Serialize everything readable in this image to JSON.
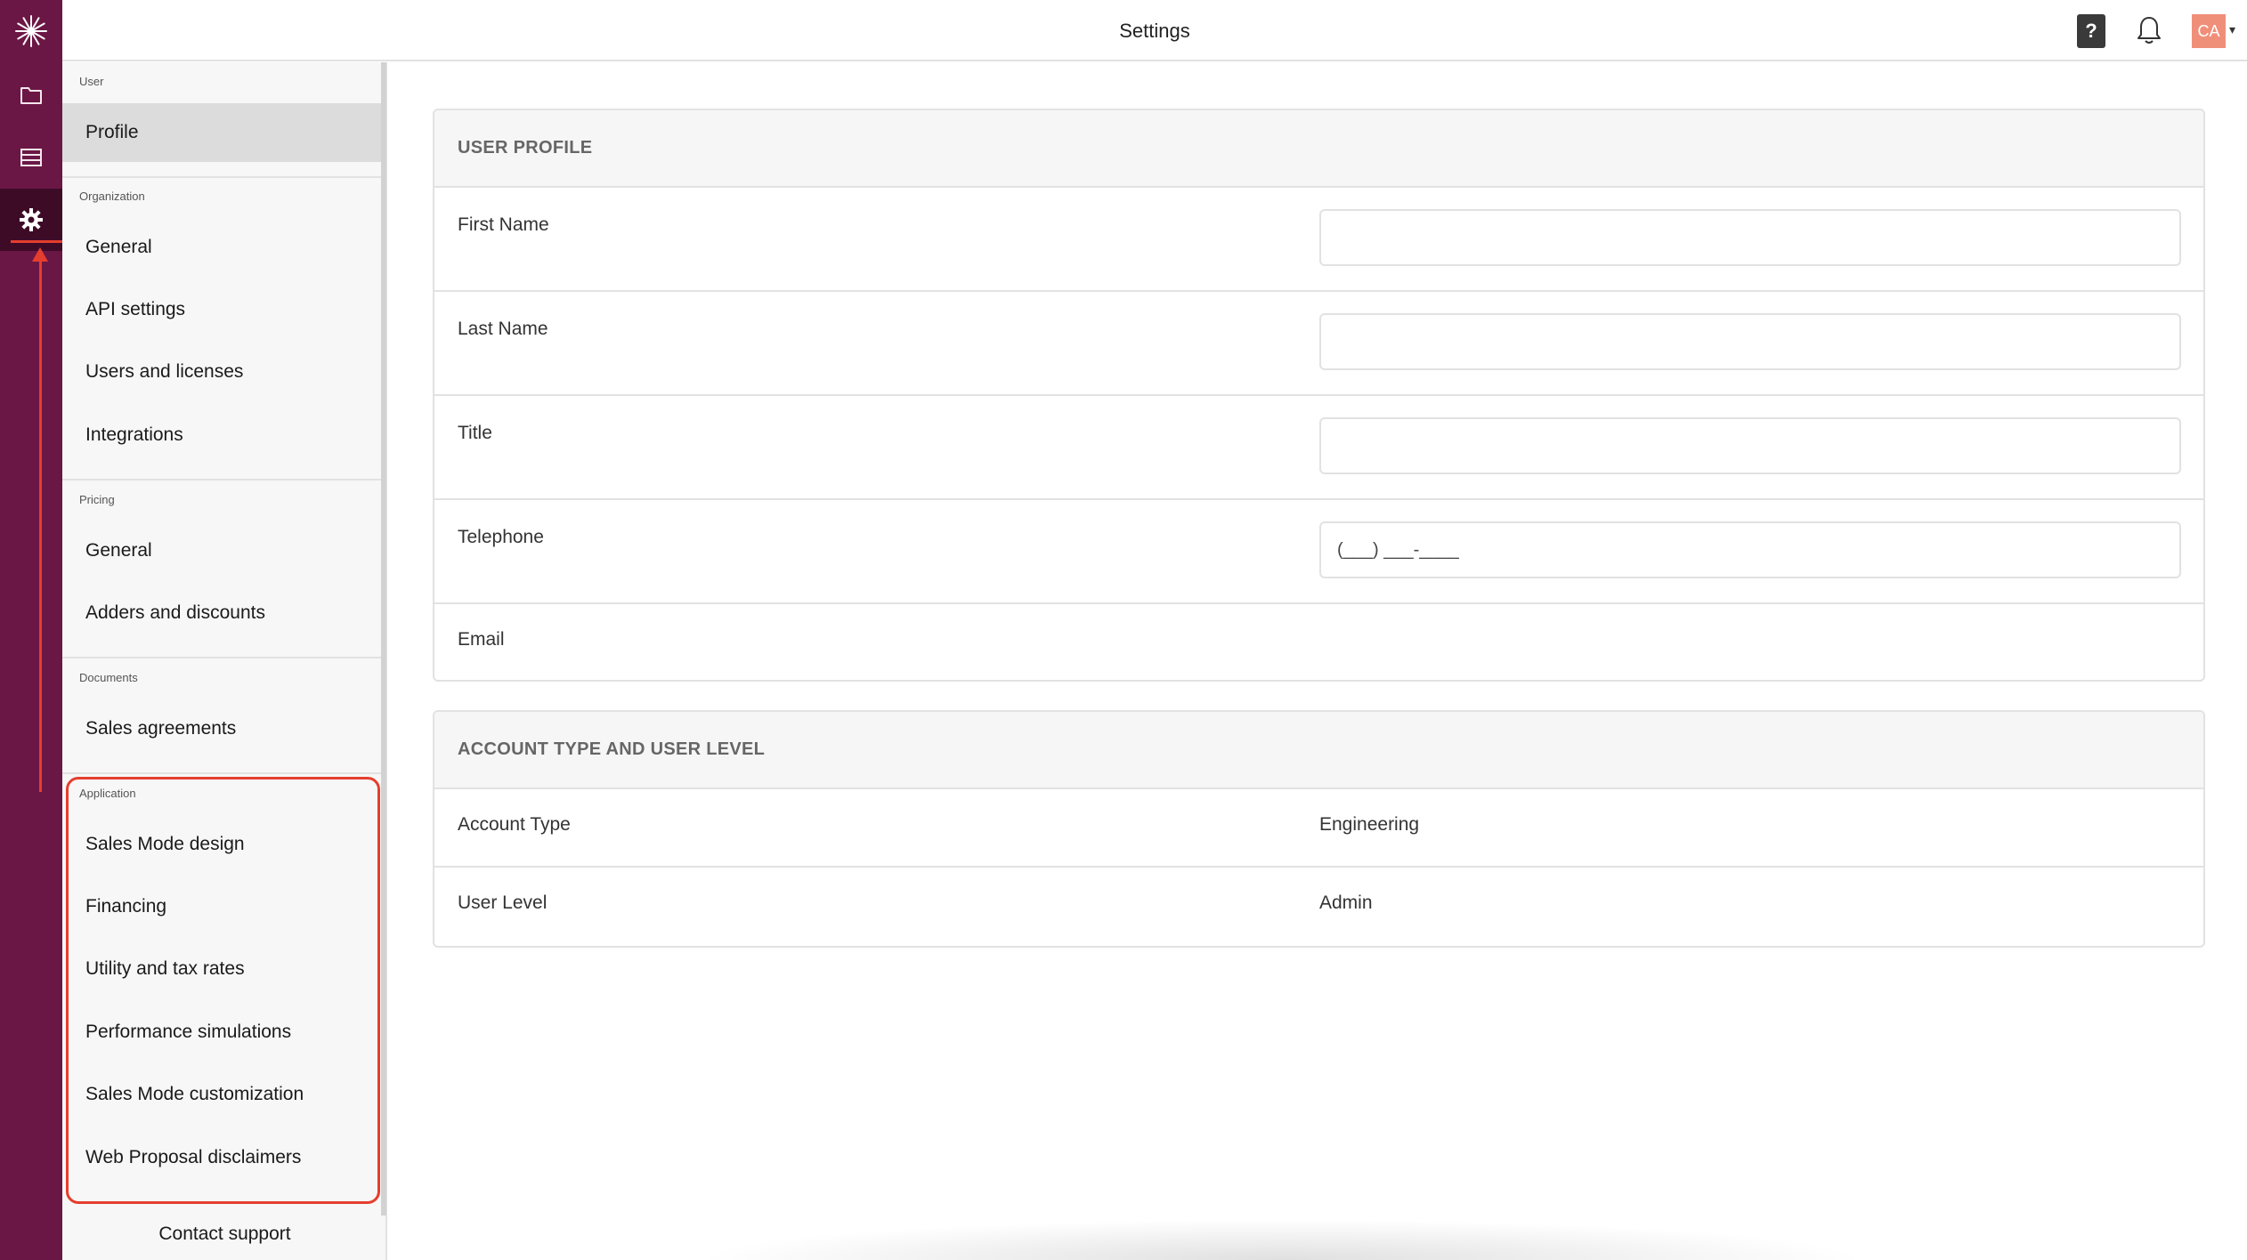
{
  "topbar": {
    "title": "Settings",
    "help_label": "?",
    "avatar_initials": "CA"
  },
  "rail": {
    "items": [
      {
        "icon": "sunburst-logo-icon"
      },
      {
        "icon": "folder-icon"
      },
      {
        "icon": "list-icon"
      },
      {
        "icon": "gear-icon",
        "active": true
      }
    ]
  },
  "sidebar": {
    "sections": [
      {
        "header": "User",
        "items": [
          {
            "label": "Profile",
            "selected": true
          }
        ]
      },
      {
        "header": "Organization",
        "items": [
          {
            "label": "General"
          },
          {
            "label": "API settings"
          },
          {
            "label": "Users and licenses"
          },
          {
            "label": "Integrations"
          }
        ]
      },
      {
        "header": "Pricing",
        "items": [
          {
            "label": "General"
          },
          {
            "label": "Adders and discounts"
          }
        ]
      },
      {
        "header": "Documents",
        "items": [
          {
            "label": "Sales agreements"
          }
        ]
      },
      {
        "header": "Application",
        "items": [
          {
            "label": "Sales Mode design"
          },
          {
            "label": "Financing"
          },
          {
            "label": "Utility and tax rates"
          },
          {
            "label": "Performance simulations"
          },
          {
            "label": "Sales Mode customization"
          },
          {
            "label": "Web Proposal disclaimers"
          }
        ]
      }
    ],
    "contact_support": "Contact support"
  },
  "user_profile": {
    "header": "USER PROFILE",
    "fields": [
      {
        "label": "First Name",
        "value": ""
      },
      {
        "label": "Last Name",
        "value": ""
      },
      {
        "label": "Title",
        "value": ""
      },
      {
        "label": "Telephone",
        "value": "(___) ___-____"
      },
      {
        "label": "Email"
      }
    ]
  },
  "account": {
    "header": "ACCOUNT TYPE AND USER LEVEL",
    "rows": [
      {
        "label": "Account Type",
        "value": "Engineering"
      },
      {
        "label": "User Level",
        "value": "Admin"
      }
    ]
  },
  "colors": {
    "rail_bg": "#6b1745",
    "rail_active": "#3e0b27",
    "annotation_red": "#e53e2e",
    "avatar_bg": "#f08f79"
  }
}
